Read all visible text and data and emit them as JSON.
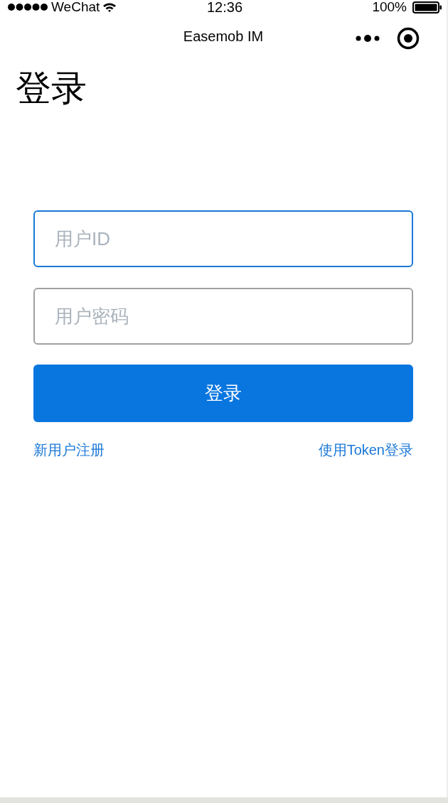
{
  "status_bar": {
    "carrier": "WeChat",
    "time": "12:36",
    "battery": "100%"
  },
  "nav_bar": {
    "title": "Easemob IM"
  },
  "page": {
    "heading": "登录"
  },
  "fields": [
    {
      "placeholder": "用户ID",
      "focused": true
    },
    {
      "placeholder": "用户密码",
      "focused": false
    }
  ],
  "login_button": {
    "label": "登录"
  },
  "links": [
    {
      "label": "新用户注册"
    },
    {
      "label": "使用Token登录"
    }
  ]
}
